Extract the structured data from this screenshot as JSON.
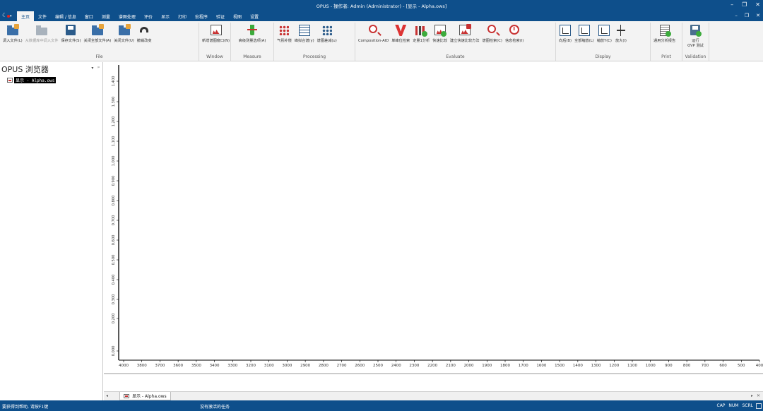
{
  "window": {
    "title": "OPUS - 操作者: Admin  (Administrator) - [显示 - Alpha.ows]",
    "controls": [
      "–",
      "❐",
      "✕"
    ],
    "doc_controls": [
      "–",
      "❐",
      "✕"
    ]
  },
  "menu": {
    "tabs": [
      "主页",
      "文件",
      "编辑 / 信息",
      "窗口",
      "测量",
      "谱图处理",
      "评价",
      "显示",
      "打印",
      "宏程序",
      "验证",
      "视图",
      "设置"
    ],
    "active": "主页"
  },
  "ribbon": {
    "file": {
      "label": "File",
      "buttons": [
        "调入文件(L)",
        "从数据库中调入文件",
        "保存文件(S)",
        "关闭全部文件(A)",
        "关闭文件(U)",
        "撤销改变"
      ]
    },
    "window": {
      "label": "Window",
      "buttons": [
        "新增谱图窗口(N)"
      ]
    },
    "measure": {
      "label": "Measure",
      "buttons": [
        "高级测量选项(A)"
      ]
    },
    "processing": {
      "label": "Processing",
      "buttons": [
        "气氛补偿",
        "峰拟合谱(y)",
        "谱图差减(u)"
      ]
    },
    "evaluate": {
      "label": "Evaluate",
      "buttons": [
        "Composition-AID",
        "单峰位检索",
        "定量1分析",
        "快速比较",
        "建立快速比较方法",
        "谱图检索(C)",
        "信息检索(I)"
      ]
    },
    "display": {
      "label": "Display",
      "buttons": [
        "向后(B)",
        "全部缩放(L)",
        "缩放Y(C)",
        "放大(I)"
      ]
    },
    "print": {
      "label": "Print",
      "buttons": [
        "通用分析报告"
      ]
    },
    "validation": {
      "label": "Validation",
      "buttons": [
        "运行\nOVP 测试"
      ]
    }
  },
  "browser": {
    "title": "OPUS 浏览器",
    "controls": [
      "▾",
      "ᵖ"
    ],
    "item": "显示 - Alpha.ows"
  },
  "doc_tabs": {
    "left_arrow": "◂",
    "tab": "显示 - Alpha.ows",
    "right_controls": [
      "▸",
      "✕"
    ]
  },
  "status": {
    "help": "要获得到帮助, 请按F1键",
    "tasks": "没有激活的任务",
    "indicators": [
      "CAP",
      "NUM",
      "SCRL"
    ]
  },
  "chart_data": {
    "type": "line",
    "series": [],
    "xlim": [
      4000,
      400
    ],
    "ylim": [
      0,
      1.5
    ],
    "xticks": [
      4000,
      3800,
      3700,
      3600,
      3500,
      3400,
      3300,
      3200,
      3100,
      3000,
      2900,
      2800,
      2700,
      2600,
      2500,
      2400,
      2300,
      2200,
      2100,
      2000,
      1900,
      1800,
      1700,
      1600,
      1500,
      1400,
      1300,
      1200,
      1100,
      1000,
      900,
      800,
      700,
      600,
      500,
      400
    ],
    "yticks": [
      "0.000",
      "0.200",
      "0.300",
      "0.400",
      "0.500",
      "0.600",
      "0.700",
      "0.800",
      "0.900",
      "1.000",
      "1.100",
      "1.200",
      "1.300",
      "1.400"
    ],
    "grid": false
  }
}
